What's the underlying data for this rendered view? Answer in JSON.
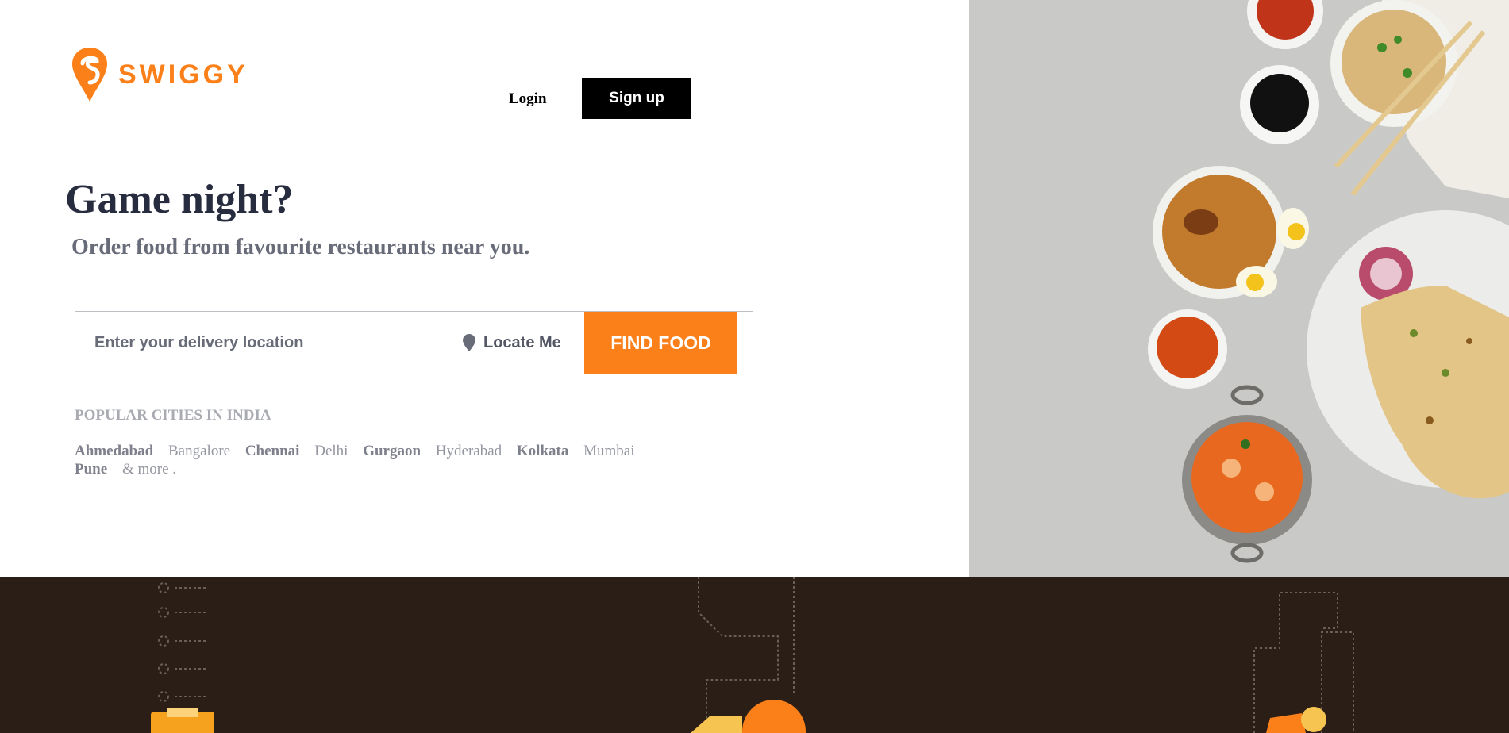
{
  "brand": {
    "name": "SWIGGY",
    "color": "#fc8019",
    "icon": "swiggy-logo-icon"
  },
  "nav": {
    "login_label": "Login",
    "signup_label": "Sign up"
  },
  "hero": {
    "headline": "Game night?",
    "subline": "Order food from favourite restaurants near you."
  },
  "search": {
    "placeholder": "Enter your delivery location",
    "locate_label": "Locate Me",
    "locate_icon": "location-pin-icon",
    "find_label": "FIND FOOD"
  },
  "popular": {
    "title": "POPULAR CITIES IN INDIA",
    "cities": [
      {
        "name": "Ahmedabad",
        "bold": true
      },
      {
        "name": "Bangalore",
        "bold": false
      },
      {
        "name": "Chennai",
        "bold": true
      },
      {
        "name": "Delhi",
        "bold": false
      },
      {
        "name": "Gurgaon",
        "bold": true
      },
      {
        "name": "Hyderabad",
        "bold": false
      },
      {
        "name": "Kolkata",
        "bold": true
      },
      {
        "name": "Mumbai",
        "bold": false
      },
      {
        "name": "Pune",
        "bold": true
      }
    ],
    "more_label": "& more ."
  },
  "colors": {
    "accent": "#fc8019",
    "dark_band": "#2b1e16",
    "food_bg": "#c7c7c5"
  }
}
